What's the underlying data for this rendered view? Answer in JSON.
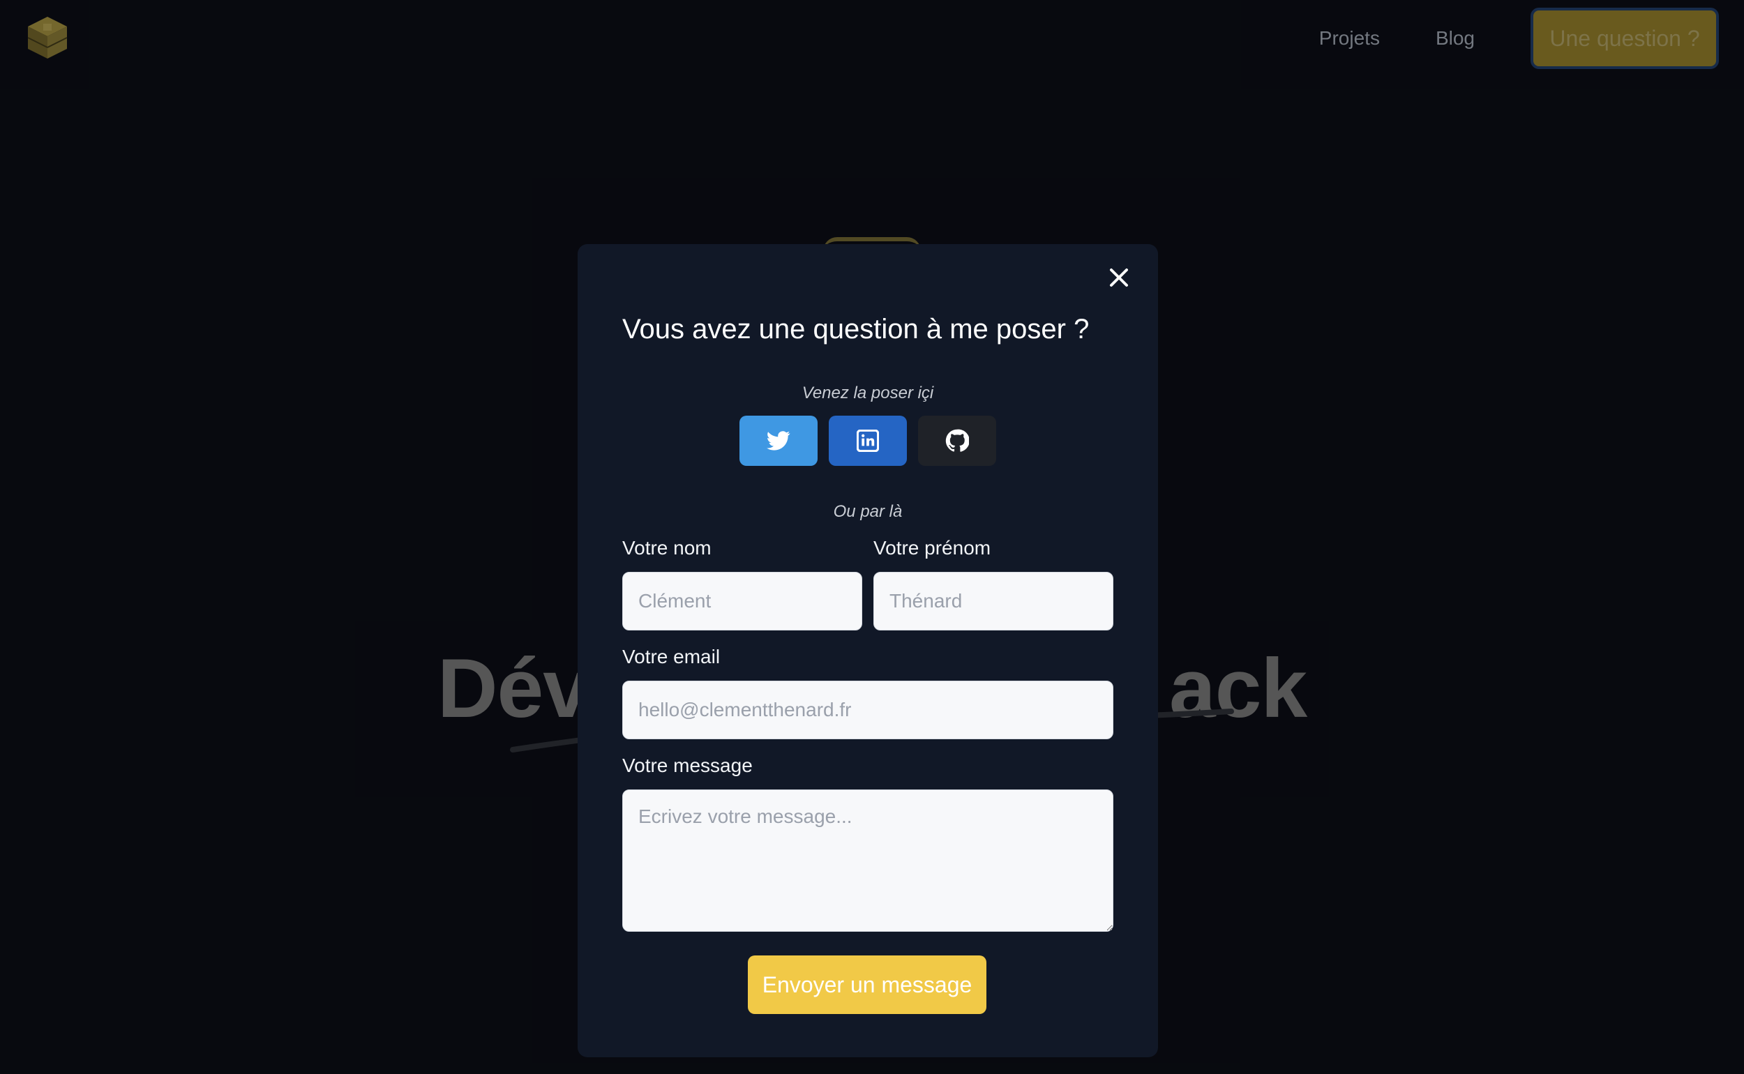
{
  "nav": {
    "logo_icon": "stacked-cube-logo",
    "links": [
      {
        "label": "Projets"
      },
      {
        "label": "Blog"
      }
    ],
    "cta_label": "Une question ?"
  },
  "hero": {
    "title_left": "Dév",
    "title_right": "ack"
  },
  "modal": {
    "close_icon": "close-icon",
    "title": "Vous avez une question à me poser ?",
    "socials_caption": "Venez la poser içi",
    "socials": [
      {
        "name": "twitter",
        "icon": "twitter-icon",
        "color": "#3f98e3"
      },
      {
        "name": "linkedin",
        "icon": "linkedin-icon",
        "color": "#2565c4"
      },
      {
        "name": "github",
        "icon": "github-icon",
        "color": "#1f2228"
      }
    ],
    "form_caption": "Ou par là",
    "form": {
      "lastname_label": "Votre nom",
      "lastname_placeholder": "Clément",
      "firstname_label": "Votre prénom",
      "firstname_placeholder": "Thénard",
      "email_label": "Votre email",
      "email_placeholder": "hello@clementthenard.fr",
      "message_label": "Votre message",
      "message_placeholder": "Ecrivez votre message...",
      "submit_label": "Envoyer un message"
    }
  },
  "colors": {
    "accent": "#f1c947",
    "background": "#0b0d14",
    "modal_bg": "#111827"
  }
}
